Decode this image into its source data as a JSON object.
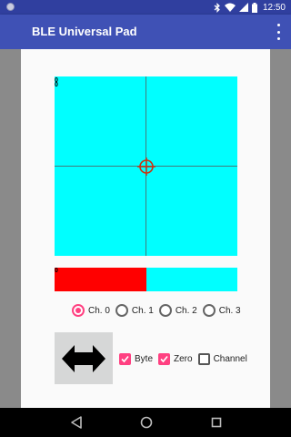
{
  "status_bar": {
    "time": "12:50",
    "icons": [
      "notification-dot-icon",
      "bluetooth-icon",
      "wifi-icon",
      "cell-signal-icon",
      "battery-icon"
    ]
  },
  "app_bar": {
    "title": "BLE Universal Pad",
    "menu_icon": "overflow-menu-icon"
  },
  "pad": {
    "x_value": "0",
    "y_value": "0"
  },
  "slider": {
    "value_label": "0",
    "fill_fraction": 0.5
  },
  "channels": {
    "options": [
      "Ch. 0",
      "Ch. 1",
      "Ch. 2",
      "Ch. 3"
    ],
    "selected_index": 0
  },
  "action_button": {
    "icon": "double-arrow-horizontal-icon"
  },
  "options": {
    "byte_label": "Byte",
    "byte_checked": true,
    "zero_label": "Zero",
    "zero_checked": true,
    "channel_label": "Channel",
    "channel_checked": false
  },
  "colors": {
    "primary": "#3F51B5",
    "primary_dark": "#303F9F",
    "accent": "#FF4081",
    "pad_background": "#00FFFF",
    "slider_fill": "#FF0000"
  }
}
